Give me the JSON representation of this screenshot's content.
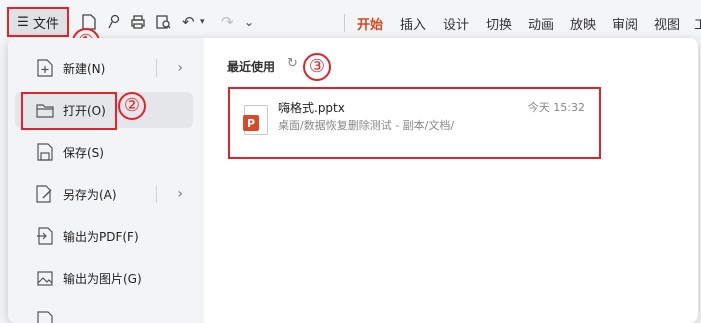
{
  "toolbar": {
    "file_label": "文件",
    "icons": [
      "menu-icon",
      "new-doc-icon",
      "pin-icon",
      "print-icon",
      "print-preview-icon",
      "undo-icon",
      "redo-icon",
      "more-icon"
    ]
  },
  "tabs": [
    "开始",
    "插入",
    "设计",
    "切换",
    "动画",
    "放映",
    "审阅",
    "视图",
    "工"
  ],
  "menu": {
    "items": [
      {
        "label": "新建(N)",
        "icon": "new-icon",
        "has_arrow": true
      },
      {
        "label": "打开(O)",
        "icon": "folder-icon",
        "has_arrow": false
      },
      {
        "label": "保存(S)",
        "icon": "save-icon",
        "has_arrow": false
      },
      {
        "label": "另存为(A)",
        "icon": "save-as-icon",
        "has_arrow": true
      },
      {
        "label": "输出为PDF(F)",
        "icon": "pdf-export-icon",
        "has_arrow": false
      },
      {
        "label": "输出为图片(G)",
        "icon": "image-export-icon",
        "has_arrow": false
      }
    ]
  },
  "recent": {
    "title": "最近使用",
    "files": [
      {
        "name": "嗨格式.pptx",
        "path": "桌面/数据恢复删除测试 - 副本/文档/",
        "time": "今天 15:32",
        "badge": "P"
      }
    ]
  },
  "annotations": [
    "①",
    "②",
    "③"
  ],
  "colors": {
    "accent": "#d9461f",
    "annotation": "#e0242b",
    "ppt": "#d84a2a"
  }
}
